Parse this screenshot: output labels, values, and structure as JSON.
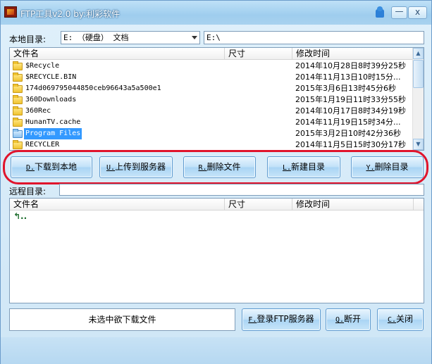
{
  "window": {
    "title": "FTP工具v2.0  by:利彩软件",
    "minimize_glyph": "—",
    "close_glyph": "x"
  },
  "local": {
    "label": "本地目录:",
    "drive_selected": "E: （硬盘） 文档",
    "path": "E:\\",
    "columns": [
      "文件名",
      "尺寸",
      "修改时间"
    ],
    "files": [
      {
        "name": "$Recycle",
        "size": "",
        "time": "2014年10月28日8时39分25秒",
        "selected": false
      },
      {
        "name": "$RECYCLE.BIN",
        "size": "",
        "time": "2014年11月13日10时15分...",
        "selected": false
      },
      {
        "name": "174d069795044850ceb96643a5a500e1",
        "size": "",
        "time": "2015年3月6日13时45分6秒",
        "selected": false
      },
      {
        "name": "360Downloads",
        "size": "",
        "time": "2015年1月19日11时33分55秒",
        "selected": false
      },
      {
        "name": "360Rec",
        "size": "",
        "time": "2014年10月17日8时34分19秒",
        "selected": false
      },
      {
        "name": "HunanTV.cache",
        "size": "",
        "time": "2014年11月19日15时34分...",
        "selected": false
      },
      {
        "name": "Program Files",
        "size": "",
        "time": "2015年3月2日10时42分36秒",
        "selected": true
      },
      {
        "name": "RECYCLER",
        "size": "",
        "time": "2014年11月5日15时30分17秒",
        "selected": false
      }
    ]
  },
  "actions": {
    "download": {
      "key": "D.",
      "label": "下载到本地"
    },
    "upload": {
      "key": "U.",
      "label": "上传到服务器"
    },
    "delete_file": {
      "key": "R.",
      "label": "删除文件"
    },
    "new_dir": {
      "key": "L.",
      "label": "新建目录"
    },
    "delete_dir": {
      "key": "Y.",
      "label": "删除目录"
    }
  },
  "remote": {
    "label": "远程目录:",
    "path": "",
    "columns": [
      "文件名",
      "尺寸",
      "修改时间"
    ],
    "parent_entry_glyph": "↰.."
  },
  "footer": {
    "status": "未选中欲下载文件",
    "login": {
      "key": "F.",
      "label": "登录FTP服务器"
    },
    "disconnect": {
      "key": "Q.",
      "label": "断开"
    },
    "close": {
      "key": "C.",
      "label": "关闭"
    }
  },
  "colors": {
    "highlight_ring": "#e0142c",
    "selection": "#3399ff",
    "button_border": "#5f9bd0"
  }
}
